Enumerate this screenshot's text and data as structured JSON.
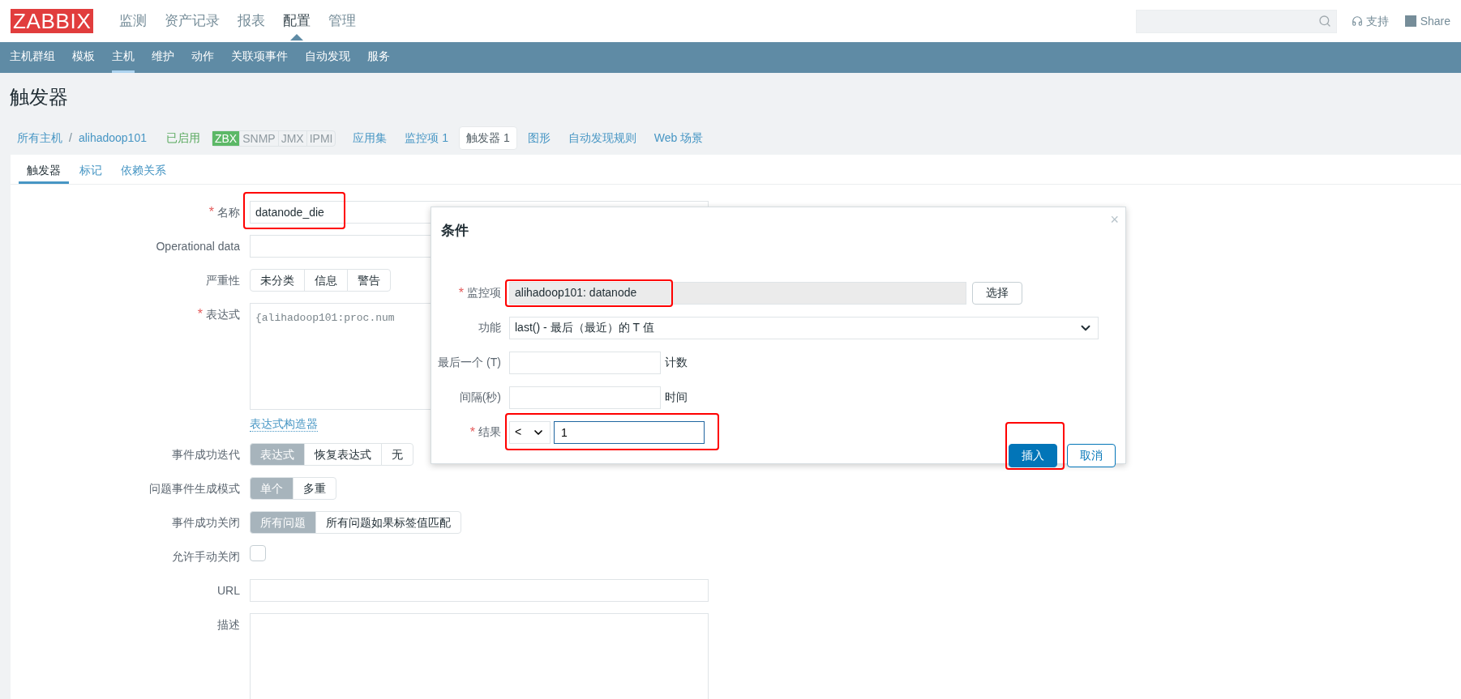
{
  "header": {
    "logo": "ZABBIX",
    "menu": [
      {
        "label": "监测",
        "selected": false
      },
      {
        "label": "资产记录",
        "selected": false
      },
      {
        "label": "报表",
        "selected": false
      },
      {
        "label": "配置",
        "selected": true
      },
      {
        "label": "管理",
        "selected": false
      }
    ],
    "support": "支持",
    "share": "Share"
  },
  "subnav": [
    {
      "label": "主机群组",
      "selected": false
    },
    {
      "label": "模板",
      "selected": false
    },
    {
      "label": "主机",
      "selected": true
    },
    {
      "label": "维护",
      "selected": false
    },
    {
      "label": "动作",
      "selected": false
    },
    {
      "label": "关联项事件",
      "selected": false
    },
    {
      "label": "自动发现",
      "selected": false
    },
    {
      "label": "服务",
      "selected": false
    }
  ],
  "page_title": "触发器",
  "breadcrumb": {
    "all_hosts": "所有主机",
    "separator": "/",
    "host": "alihadoop101",
    "status": "已启用",
    "availability": [
      {
        "label": "ZBX",
        "on": true
      },
      {
        "label": "SNMP",
        "on": false
      },
      {
        "label": "JMX",
        "on": false
      },
      {
        "label": "IPMI",
        "on": false
      }
    ]
  },
  "host_tabs": [
    {
      "label": "应用集",
      "selected": false
    },
    {
      "label": "监控项 1",
      "selected": false
    },
    {
      "label": "触发器 1",
      "selected": true
    },
    {
      "label": "图形",
      "selected": false
    },
    {
      "label": "自动发现规则",
      "selected": false
    },
    {
      "label": "Web 场景",
      "selected": false
    }
  ],
  "form_tabs": [
    {
      "label": "触发器",
      "selected": true
    },
    {
      "label": "标记",
      "selected": false
    },
    {
      "label": "依赖关系",
      "selected": false
    }
  ],
  "form_rows": [
    {
      "kind": "text",
      "label": "名称",
      "required_mark": "*",
      "value": "datanode_die",
      "highlighted": true
    },
    {
      "kind": "text",
      "label": "Operational data",
      "value": "",
      "highlighted": false
    },
    {
      "kind": "segmented",
      "label": "严重性",
      "options": [
        {
          "label": "未分类",
          "selected": false
        },
        {
          "label": "信息",
          "selected": false
        },
        {
          "label": "警告",
          "selected": false
        }
      ]
    },
    {
      "kind": "expression",
      "label": "表达式",
      "required_mark": "*",
      "value": "{alihadoop101:proc.num",
      "link": "表达式构造器"
    },
    {
      "kind": "segmented",
      "label": "事件成功迭代",
      "options": [
        {
          "label": "表达式",
          "selected": true
        },
        {
          "label": "恢复表达式",
          "selected": false
        },
        {
          "label": "无",
          "selected": false
        }
      ]
    },
    {
      "kind": "segmented",
      "label": "问题事件生成模式",
      "options": [
        {
          "label": "单个",
          "selected": true
        },
        {
          "label": "多重",
          "selected": false
        }
      ]
    },
    {
      "kind": "segmented",
      "label": "事件成功关闭",
      "options": [
        {
          "label": "所有问题",
          "selected": true
        },
        {
          "label": "所有问题如果标签值匹配",
          "selected": false
        }
      ]
    },
    {
      "kind": "checkbox",
      "label": "允许手动关闭",
      "checked": false
    },
    {
      "kind": "text",
      "label": "URL",
      "value": "",
      "highlighted": false
    },
    {
      "kind": "textarea",
      "label": "描述",
      "value": ""
    }
  ],
  "dialog": {
    "title": "条件",
    "close": "×",
    "rows": [
      {
        "kind": "item",
        "label": "监控项",
        "required_mark": "*",
        "value": "alihadoop101: datanode",
        "button": "选择",
        "highlighted": true
      },
      {
        "kind": "select",
        "label": "功能",
        "value": "last() - 最后（最近）的 T 值"
      },
      {
        "kind": "input",
        "label": "最后一个 (T)",
        "value": "",
        "suffix": "计数"
      },
      {
        "kind": "input",
        "label": "间隔(秒)",
        "value": "",
        "suffix": "时间"
      },
      {
        "kind": "result",
        "label": "结果",
        "required_mark": "*",
        "operator": "<",
        "value": "1",
        "highlighted": true
      }
    ],
    "buttons": [
      {
        "label": "插入",
        "kind": "primary",
        "highlighted": true
      },
      {
        "label": "取消",
        "kind": "secondary",
        "highlighted": false
      }
    ]
  }
}
